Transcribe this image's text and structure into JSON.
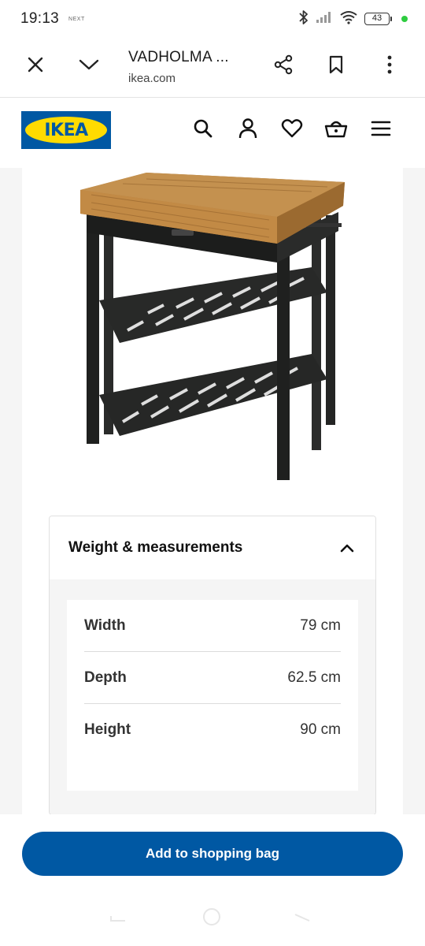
{
  "status_bar": {
    "time": "19:13",
    "next_label": "NEXT",
    "battery": "43"
  },
  "browser": {
    "title": "VADHOLMA ...",
    "domain": "ikea.com"
  },
  "ikea": {
    "logo_text": "IKEA",
    "brand_blue": "#0058a3",
    "brand_yellow": "#ffdb00"
  },
  "header_icons": [
    "search-icon",
    "account-icon",
    "heart-icon",
    "basket-icon",
    "menu-icon"
  ],
  "accordion": {
    "title": "Weight & measurements",
    "expanded": true,
    "rows": [
      {
        "label": "Width",
        "value": "79 cm"
      },
      {
        "label": "Depth",
        "value": "62.5 cm"
      },
      {
        "label": "Height",
        "value": "90 cm"
      }
    ]
  },
  "cta": {
    "label": "Add to shopping bag"
  }
}
